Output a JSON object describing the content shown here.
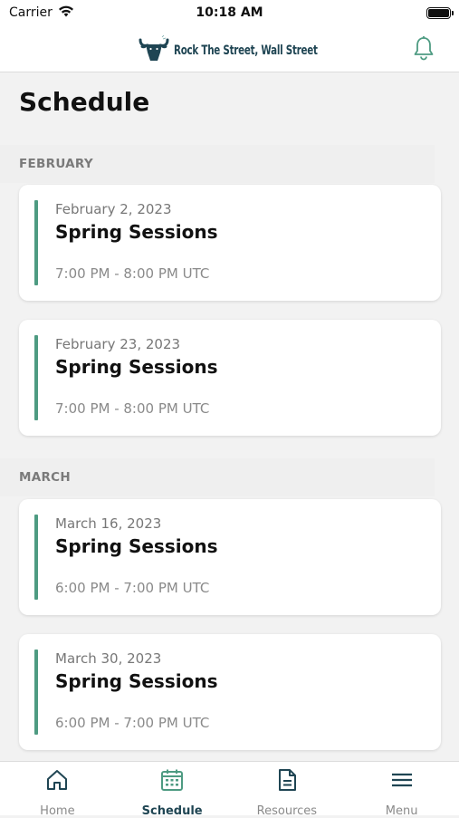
{
  "status_bar": {
    "carrier": "Carrier",
    "time": "10:18 AM"
  },
  "header": {
    "brand_name": "Rock The Street, Wall Street",
    "logo_icon": "bull-head-icon",
    "notification_icon": "bell-icon"
  },
  "page": {
    "title": "Schedule"
  },
  "months": [
    {
      "name": "FEBRUARY",
      "events": [
        {
          "date": "February 2, 2023",
          "title": "Spring Sessions",
          "time": "7:00 PM - 8:00 PM UTC"
        },
        {
          "date": "February 23, 2023",
          "title": "Spring Sessions",
          "time": "7:00 PM - 8:00 PM UTC"
        }
      ]
    },
    {
      "name": "MARCH",
      "events": [
        {
          "date": "March 16, 2023",
          "title": "Spring Sessions",
          "time": "6:00 PM - 7:00 PM UTC"
        },
        {
          "date": "March 30, 2023",
          "title": "Spring Sessions",
          "time": "6:00 PM - 7:00 PM UTC"
        }
      ]
    }
  ],
  "tabs": [
    {
      "label": "Home",
      "icon": "home-icon",
      "active": false
    },
    {
      "label": "Schedule",
      "icon": "calendar-icon",
      "active": true
    },
    {
      "label": "Resources",
      "icon": "document-icon",
      "active": false
    },
    {
      "label": "Menu",
      "icon": "hamburger-menu-icon",
      "active": false
    }
  ],
  "colors": {
    "brand": "#1f4553",
    "accent": "#4e9b82",
    "background": "#f2f2f2"
  }
}
